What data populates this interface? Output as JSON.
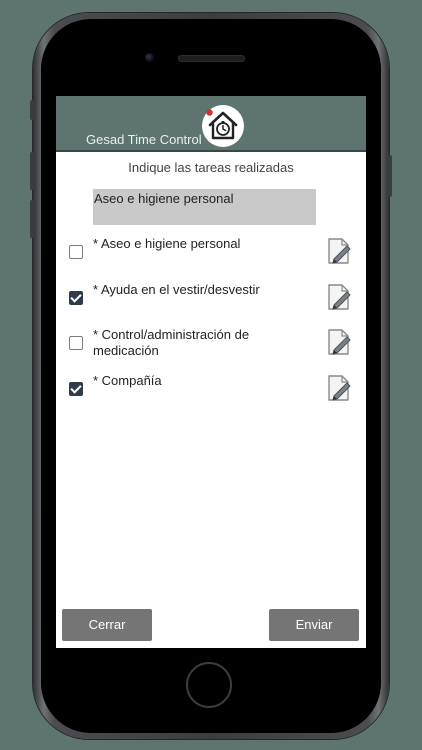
{
  "header": {
    "title": "Gesad Time Control",
    "logo_icon": "house-clock-icon"
  },
  "main": {
    "instruction": "Indique las tareas realizadas",
    "selected_task": "Aseo e higiene personal",
    "tasks": [
      {
        "label": "* Aseo e higiene personal",
        "checked": false,
        "edit_icon": "edit-note-icon"
      },
      {
        "label": "* Ayuda en el vestir/desvestir",
        "checked": true,
        "edit_icon": "edit-note-icon"
      },
      {
        "label": "* Control/administración de medicación",
        "checked": false,
        "edit_icon": "edit-note-icon"
      },
      {
        "label": "* Compañía",
        "checked": true,
        "edit_icon": "edit-note-icon"
      }
    ]
  },
  "footer": {
    "close_label": "Cerrar",
    "send_label": "Enviar"
  },
  "colors": {
    "background": "#5d7470",
    "header": "#5d7470",
    "button": "#757575",
    "checkbox_checked": "#2f3b48",
    "selected_task_bg": "#c9c9c9"
  }
}
